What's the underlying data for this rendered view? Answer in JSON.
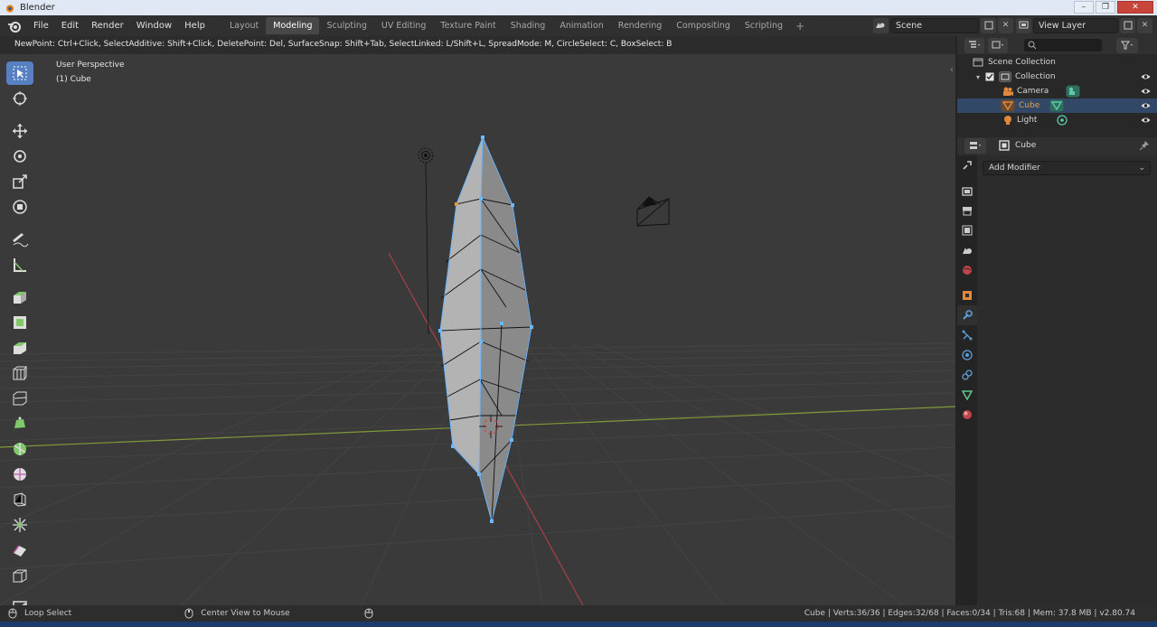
{
  "window": {
    "title": "Blender",
    "minimize": "–",
    "maximize": "❐",
    "close": "✕"
  },
  "menu": [
    "File",
    "Edit",
    "Render",
    "Window",
    "Help"
  ],
  "workspaces": [
    "Layout",
    "Modeling",
    "Sculpting",
    "UV Editing",
    "Texture Paint",
    "Shading",
    "Animation",
    "Rendering",
    "Compositing",
    "Scripting"
  ],
  "active_workspace": "Modeling",
  "add_workspace": "+",
  "scene": {
    "name": "Scene"
  },
  "view_layer": {
    "name": "View Layer"
  },
  "viewport": {
    "hint": "NewPoint: Ctrl+Click, SelectAdditive: Shift+Click, DeletePoint: Del, SurfaceSnap: Shift+Tab, SelectLinked: L/Shift+L, SpreadMode: M, CircleSelect: C, BoxSelect: B",
    "view_name": "User Perspective",
    "object_name": "(1) Cube",
    "collapse": "‹"
  },
  "tools": [
    "select-box-icon",
    "cursor-icon",
    "move-icon",
    "rotate-icon",
    "scale-icon",
    "transform-icon",
    "annotate-icon",
    "measure-icon",
    "extrude-icon",
    "inset-icon",
    "bevel-icon",
    "loop-cut-icon",
    "knife-icon",
    "poly-build-icon",
    "spin-icon",
    "smooth-icon",
    "edge-slide-icon",
    "shrink-fatten-icon",
    "shear-icon",
    "rip-icon",
    "add-cube-icon"
  ],
  "outliner": {
    "root": "Scene Collection",
    "collection": "Collection",
    "items": [
      {
        "label": "Camera",
        "active": false,
        "color": "#e0883e"
      },
      {
        "label": "Cube",
        "active": true,
        "color": "#e0883e"
      },
      {
        "label": "Light",
        "active": false,
        "color": "#e0883e"
      }
    ]
  },
  "properties": {
    "object": "Cube",
    "add_modifier": "Add Modifier",
    "tabs": [
      "tool-icon",
      "render-icon",
      "output-icon",
      "view-layer-icon",
      "scene-icon",
      "world-icon",
      "object-icon",
      "modifier-icon",
      "particles-icon",
      "physics-icon",
      "constraints-icon",
      "data-icon",
      "material-icon"
    ],
    "active_tab": 7
  },
  "status": {
    "left_action": "Loop Select",
    "middle_action": "Center View to Mouse",
    "stats": "Cube | Verts:36/36 | Edges:32/68 | Faces:0/34 | Tris:68 | Mem: 37.8 MB | v2.80.74"
  },
  "colors": {
    "accent": "#5680c2",
    "active_object": "#e5a04c",
    "x_axis": "#c0444a",
    "y_axis": "#8aaa3c",
    "vertex": "#6cb8ff"
  }
}
